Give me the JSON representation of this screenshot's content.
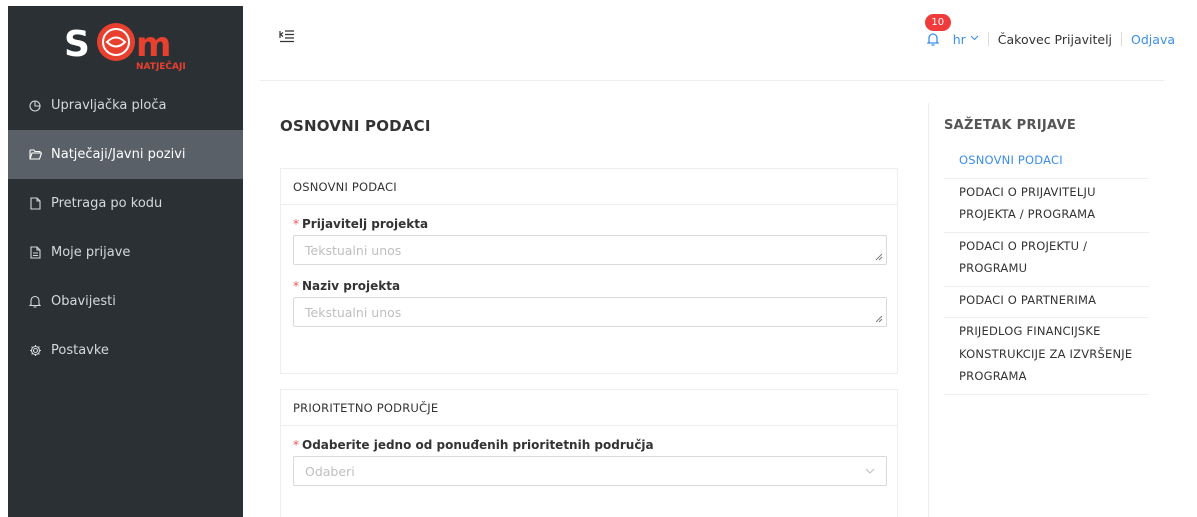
{
  "logo": {
    "text_main": "S",
    "text_sub": "NATJEČAJI",
    "accent": "#e8402e"
  },
  "sidebar": {
    "items": [
      {
        "label": "Upravljačka ploča",
        "icon": "pie-chart-icon"
      },
      {
        "label": "Natječaji/Javni pozivi",
        "icon": "folder-open-icon"
      },
      {
        "label": "Pretraga po kodu",
        "icon": "file-icon"
      },
      {
        "label": "Moje prijave",
        "icon": "file-text-icon"
      },
      {
        "label": "Obavijesti",
        "icon": "bell-icon"
      },
      {
        "label": "Postavke",
        "icon": "gear-icon"
      }
    ],
    "active_index": 1,
    "bg": "#2b3035",
    "active_bg": "#5a6067"
  },
  "header": {
    "notification_count": "10",
    "language": "hr",
    "user_name": "Čakovec Prijavitelj",
    "logout_label": "Odjava",
    "link_color": "#3c8ee8",
    "badge_color": "#ef3b3b"
  },
  "main": {
    "page_title": "OSNOVNI PODACI",
    "sections": [
      {
        "title": "OSNOVNI PODACI",
        "fields": [
          {
            "label": "Prijavitelj projekta",
            "placeholder": "Tekstualni unos",
            "value": ""
          },
          {
            "label": "Naziv projekta",
            "placeholder": "Tekstualni unos",
            "value": ""
          }
        ]
      },
      {
        "title": "PRIORITETNO PODRUČJE",
        "fields": [
          {
            "label": "Odaberite jedno od ponuđenih prioritetnih područja",
            "placeholder": "Odaberi",
            "value": ""
          }
        ]
      }
    ]
  },
  "summary": {
    "title": "SAŽETAK PRIJAVE",
    "items": [
      {
        "label": "OSNOVNI PODACI",
        "active": true
      },
      {
        "label": "PODACI O PRIJAVITELJU PROJEKTA / PROGRAMA"
      },
      {
        "label": "PODACI O PROJEKTU / PROGRAMU"
      },
      {
        "label": "PODACI O PARTNERIMA"
      },
      {
        "label": "PRIJEDLOG FINANCIJSKE KONSTRUKCIJE ZA IZVRŠENJE PROGRAMA"
      }
    ]
  }
}
